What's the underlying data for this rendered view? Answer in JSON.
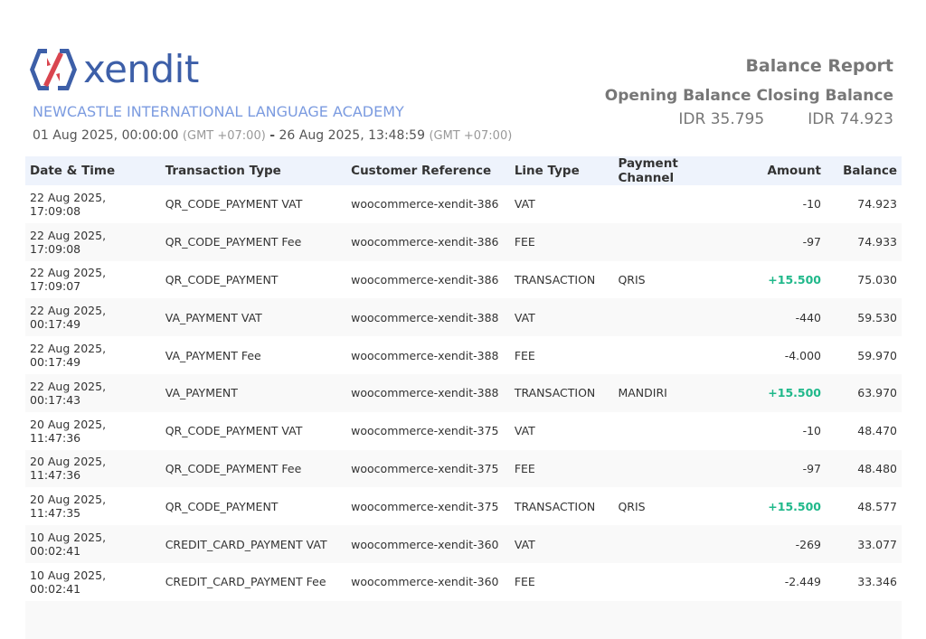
{
  "brand": {
    "name": "xendit",
    "colors": {
      "blue": "#3d5fa8",
      "red": "#d9454f"
    }
  },
  "company": "NEWCASTLE INTERNATIONAL LANGUAGE ACADEMY",
  "range": {
    "start": "01 Aug 2025, 00:00:00",
    "start_tz": "(GMT +07:00)",
    "sep": "-",
    "end": "26 Aug 2025, 13:48:59",
    "end_tz": "(GMT +07:00)"
  },
  "report": {
    "title": "Balance Report",
    "opening_label": "Opening Balance",
    "closing_label": "Closing Balance",
    "opening": "IDR 35.795",
    "closing": "IDR 74.923"
  },
  "columns": [
    "Date & Time",
    "Transaction Type",
    "Customer Reference",
    "Line Type",
    "Payment Channel",
    "Amount",
    "Balance"
  ],
  "rows": [
    [
      "22 Aug 2025, 17:09:08",
      "QR_CODE_PAYMENT VAT",
      "woocommerce-xendit-386",
      "VAT",
      "",
      "-10",
      "74.923"
    ],
    [
      "22 Aug 2025, 17:09:08",
      "QR_CODE_PAYMENT Fee",
      "woocommerce-xendit-386",
      "FEE",
      "",
      "-97",
      "74.933"
    ],
    [
      "22 Aug 2025, 17:09:07",
      "QR_CODE_PAYMENT",
      "woocommerce-xendit-386",
      "TRANSACTION",
      "QRIS",
      "+15.500",
      "75.030"
    ],
    [
      "22 Aug 2025, 00:17:49",
      "VA_PAYMENT VAT",
      "woocommerce-xendit-388",
      "VAT",
      "",
      "-440",
      "59.530"
    ],
    [
      "22 Aug 2025, 00:17:49",
      "VA_PAYMENT Fee",
      "woocommerce-xendit-388",
      "FEE",
      "",
      "-4.000",
      "59.970"
    ],
    [
      "22 Aug 2025, 00:17:43",
      "VA_PAYMENT",
      "woocommerce-xendit-388",
      "TRANSACTION",
      "MANDIRI",
      "+15.500",
      "63.970"
    ],
    [
      "20 Aug 2025, 11:47:36",
      "QR_CODE_PAYMENT VAT",
      "woocommerce-xendit-375",
      "VAT",
      "",
      "-10",
      "48.470"
    ],
    [
      "20 Aug 2025, 11:47:36",
      "QR_CODE_PAYMENT Fee",
      "woocommerce-xendit-375",
      "FEE",
      "",
      "-97",
      "48.480"
    ],
    [
      "20 Aug 2025, 11:47:35",
      "QR_CODE_PAYMENT",
      "woocommerce-xendit-375",
      "TRANSACTION",
      "QRIS",
      "+15.500",
      "48.577"
    ],
    [
      "10 Aug 2025, 00:02:41",
      "CREDIT_CARD_PAYMENT VAT",
      "woocommerce-xendit-360",
      "VAT",
      "",
      "-269",
      "33.077"
    ],
    [
      "10 Aug 2025, 00:02:41",
      "CREDIT_CARD_PAYMENT Fee",
      "woocommerce-xendit-360",
      "FEE",
      "",
      "-2.449",
      "33.346"
    ]
  ]
}
